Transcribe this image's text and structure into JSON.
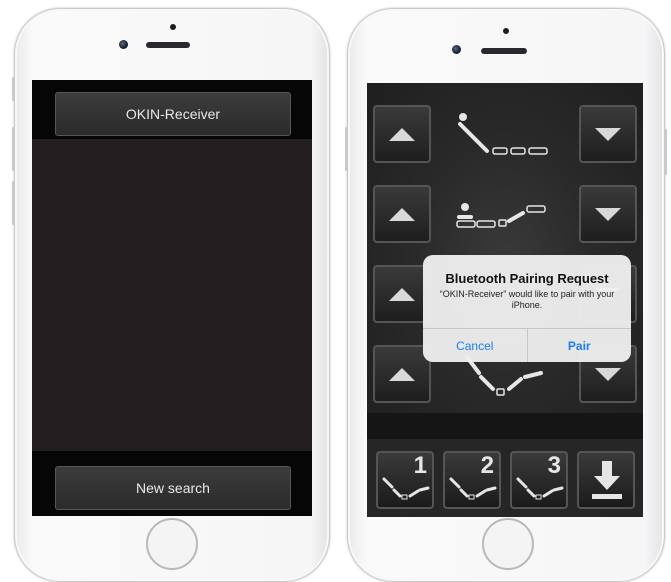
{
  "left_phone": {
    "device_button_label": "OKIN-Receiver",
    "new_search_label": "New search"
  },
  "right_phone": {
    "control_rows": [
      {
        "up_icon": "arrow-up-icon",
        "pose_icon": "head-raise-icon",
        "down_icon": "arrow-down-icon"
      },
      {
        "up_icon": "arrow-up-icon",
        "pose_icon": "foot-raise-icon",
        "down_icon": "arrow-down-icon"
      },
      {
        "up_icon": "arrow-up-icon",
        "pose_icon": "tilt-icon",
        "down_icon": "arrow-down-icon"
      },
      {
        "up_icon": "arrow-up-icon",
        "pose_icon": "zero-gravity-icon",
        "down_icon": "arrow-down-icon"
      }
    ],
    "memory_buttons": [
      {
        "number": "1",
        "icon": "memory-pose-icon"
      },
      {
        "number": "2",
        "icon": "memory-pose-icon"
      },
      {
        "number": "3",
        "icon": "memory-pose-icon"
      }
    ],
    "flat_button_icon": "flat-download-icon",
    "alert": {
      "title": "Bluetooth Pairing Request",
      "message": "“OKIN-Receiver” would like to pair with your iPhone.",
      "cancel_label": "Cancel",
      "pair_label": "Pair",
      "accent_color": "#1a7cf5"
    }
  }
}
